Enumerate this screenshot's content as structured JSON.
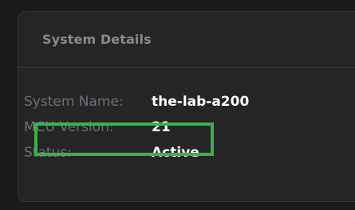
{
  "panel": {
    "title": "System Details"
  },
  "details": {
    "rows": [
      {
        "label": "System Name:",
        "value": "the-lab-a200"
      },
      {
        "label": "MCU Version:",
        "value": "21"
      },
      {
        "label": "Status:",
        "value": "Active"
      }
    ]
  },
  "highlight": {
    "color": "#37b34a"
  }
}
